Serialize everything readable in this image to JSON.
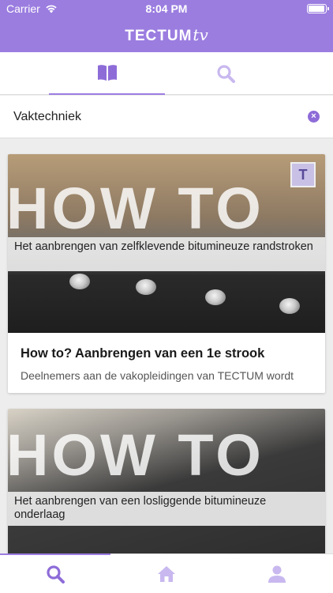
{
  "status_bar": {
    "carrier": "Carrier",
    "time": "8:04 PM",
    "battery_level": 1.0
  },
  "app": {
    "logo_main": "TECTUM",
    "logo_suffix": "tv"
  },
  "tabs": [
    {
      "id": "library",
      "icon": "book-open-icon",
      "active": true
    },
    {
      "id": "search",
      "icon": "search-icon",
      "active": false
    }
  ],
  "filter": {
    "value": "Vaktechniek",
    "clear_icon": "clear-icon"
  },
  "cards": [
    {
      "thumbnail_overlay": "HOW TO",
      "thumbnail_caption": "Het aanbrengen van zelfklevende bitumineuze randstroken",
      "badge": "T",
      "title": "How to? Aanbrengen van een 1e strook",
      "description": "Deelnemers aan de vakopleidingen van TECTUM wordt"
    },
    {
      "thumbnail_overlay": "HOW TO",
      "thumbnail_caption": "Het aanbrengen van een losliggende bitumineuze onderlaag"
    }
  ],
  "bottom_nav": [
    {
      "id": "search",
      "icon": "search-icon",
      "active": true
    },
    {
      "id": "home",
      "icon": "home-icon",
      "active": false
    },
    {
      "id": "profile",
      "icon": "user-icon",
      "active": false
    }
  ],
  "colors": {
    "brand": "#9b7de0",
    "active_icon": "#8e6cd8",
    "inactive_icon": "#c8b8ef"
  }
}
